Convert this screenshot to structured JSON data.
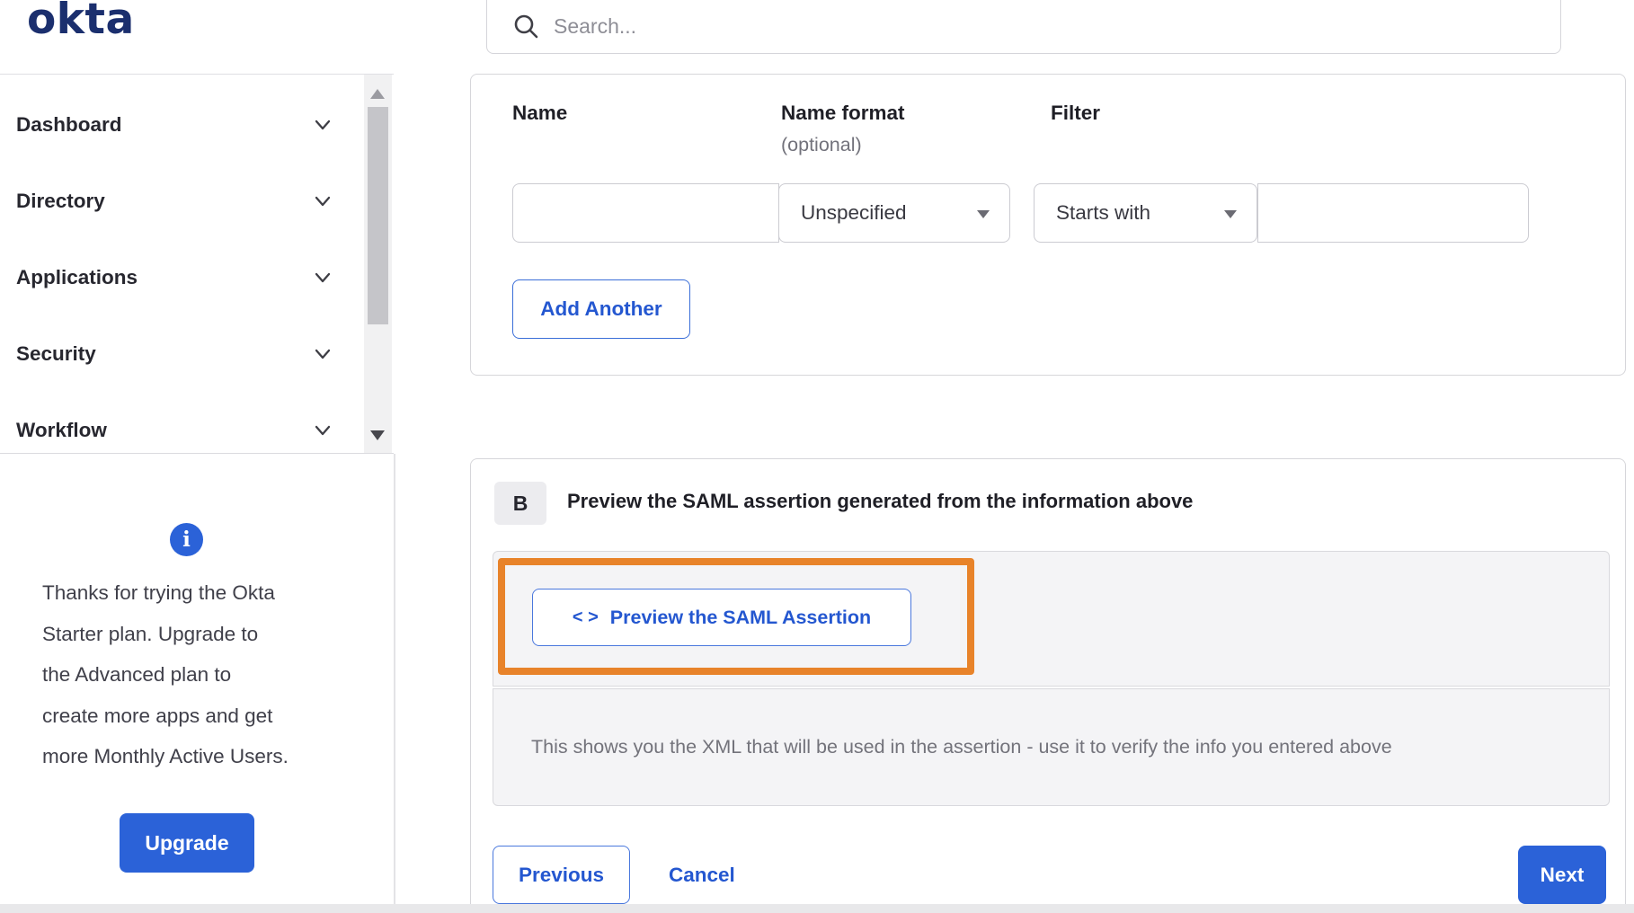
{
  "brand": {
    "logo": "okta"
  },
  "header": {
    "search_placeholder": "Search..."
  },
  "sidebar": {
    "items": [
      {
        "label": "Dashboard"
      },
      {
        "label": "Directory"
      },
      {
        "label": "Applications"
      },
      {
        "label": "Security"
      },
      {
        "label": "Workflow"
      }
    ]
  },
  "upgrade_panel": {
    "message_lines": [
      "Thanks for trying the Okta",
      "Starter plan. Upgrade to",
      "the Advanced plan to",
      "create more apps and get",
      "more Monthly Active Users."
    ],
    "button_label": "Upgrade"
  },
  "attribute_statements": {
    "columns": {
      "name_label": "Name",
      "name_format_label": "Name format",
      "name_format_optional": "(optional)",
      "filter_label": "Filter"
    },
    "row": {
      "name_value": "",
      "name_format_selected": "Unspecified",
      "filter_type_selected": "Starts with",
      "filter_value": ""
    },
    "add_another_label": "Add Another"
  },
  "preview_section": {
    "step_badge": "B",
    "title": "Preview the SAML assertion generated from the information above",
    "preview_button_label": "Preview the SAML Assertion",
    "description": "This shows you the XML that will be used in the assertion - use it to verify the info you entered above"
  },
  "wizard_footer": {
    "previous_label": "Previous",
    "cancel_label": "Cancel",
    "next_label": "Next"
  },
  "colors": {
    "accent_blue": "#2b62d8",
    "logo_navy": "#1b2f6e",
    "highlight_orange": "#e8832a",
    "panel_gray": "#f4f4f6"
  }
}
